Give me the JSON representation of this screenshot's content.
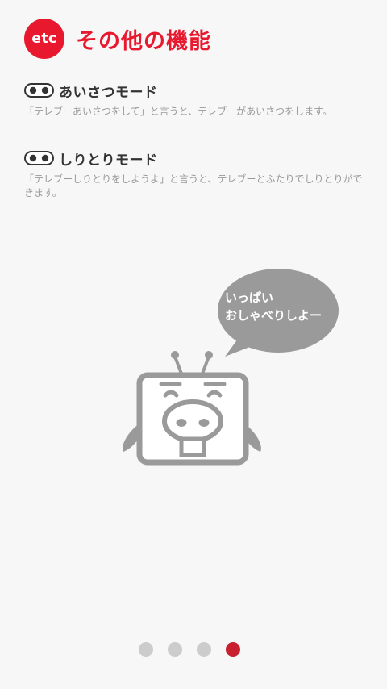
{
  "colors": {
    "accent": "#e8182e",
    "text_dark": "#333333",
    "text_muted": "#999999",
    "illustration": "#9a9a9a",
    "dot_inactive": "#cccccc",
    "dot_active": "#c8202e"
  },
  "header": {
    "badge_label": "etc",
    "title": "その他の機能"
  },
  "sections": [
    {
      "icon": "eyes-icon",
      "title": "あいさつモード",
      "description": "「テレブーあいさつをして」と言うと、テレブーがあいさつをします。"
    },
    {
      "icon": "eyes-icon",
      "title": "しりとりモード",
      "description": "「テレブーしりとりをしようよ」と言うと、テレブーとふたりでしりとりができます。"
    }
  ],
  "mascot": {
    "icon": "telebu-robot-icon",
    "speech_lines": [
      "いっぱい",
      "おしゃべりしよー"
    ]
  },
  "pagination": {
    "total": 4,
    "current": 4
  }
}
